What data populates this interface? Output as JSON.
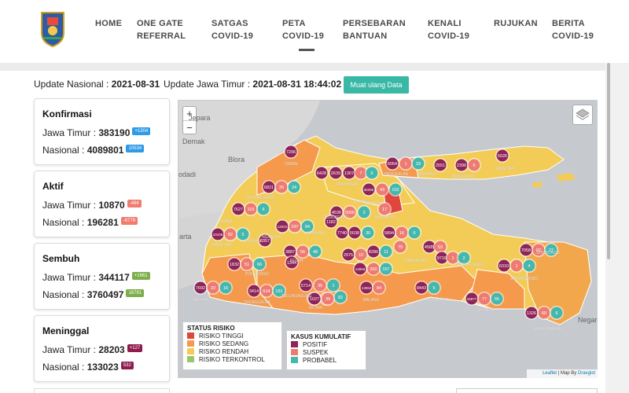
{
  "nav": {
    "items": [
      {
        "line1": "HOME",
        "line2": ""
      },
      {
        "line1": "ONE GATE",
        "line2": "REFERRAL"
      },
      {
        "line1": "SATGAS",
        "line2": "COVID-19"
      },
      {
        "line1": "PETA",
        "line2": "COVID-19"
      },
      {
        "line1": "PERSEBARAN",
        "line2": "BANTUAN"
      },
      {
        "line1": "KENALI",
        "line2": "COVID-19"
      },
      {
        "line1": "RUJUKAN",
        "line2": ""
      },
      {
        "line1": "BERITA",
        "line2": "COVID-19"
      }
    ]
  },
  "update": {
    "national_label": "Update Nasional :",
    "national_value": "2021-08-31",
    "jatim_label": "Update Jawa Timur :",
    "jatim_value": "2021-08-31 18:44:02",
    "reload_label": "Muat ulang Data"
  },
  "cards": [
    {
      "title": "Konfirmasi",
      "jatim_label": "Jawa Timur :",
      "jatim_value": "383190",
      "jatim_delta": "+1304",
      "nas_label": "Nasional :",
      "nas_value": "4089801",
      "nas_delta": "10534"
    },
    {
      "title": "Aktif",
      "jatim_label": "Jawa Timur :",
      "jatim_value": "10870",
      "jatim_delta": "-484",
      "nas_label": "Nasional :",
      "nas_value": "196281",
      "nas_delta": "-6779"
    },
    {
      "title": "Sembuh",
      "jatim_label": "Jawa Timur :",
      "jatim_value": "344117",
      "jatim_delta": "+1661",
      "nas_label": "Nasional :",
      "nas_value": "3760497",
      "nas_delta": "16781"
    },
    {
      "title": "Meninggal",
      "jatim_label": "Jawa Timur :",
      "jatim_value": "28203",
      "jatim_delta": "+127",
      "nas_label": "Nasional :",
      "nas_value": "133023",
      "nas_delta": "532"
    }
  ],
  "colors": {
    "teal": "#3ab8a6",
    "blue_badge": "#2e9be6",
    "red_badge": "#f07b6e",
    "green_badge": "#7cae4a",
    "maroon_badge": "#8e1c4e",
    "risk_high": "#e0473c",
    "risk_medium": "#f59a4c",
    "risk_low": "#f2cc56",
    "risk_controlled": "#9cc46b",
    "positive": "#8e2458",
    "suspect": "#ee7b72",
    "probable": "#45b8ae"
  },
  "map": {
    "zoom_in": "+",
    "zoom_out": "−",
    "geo_labels": [
      "Blora",
      "Demak",
      "Jepara",
      "odadi",
      "arta",
      "Negar"
    ],
    "credit_leaflet": "Leaflet",
    "credit_sep": " | Map By ",
    "credit_author": "Draxgist",
    "legend_risk": {
      "title": "STATUS RISIKO",
      "items": [
        "RISIKO TINGGI",
        "RISIKO SEDANG",
        "RISIKO RENDAH",
        "RISIKO TERKONTROL"
      ]
    },
    "legend_cases": {
      "title": "KASUS KUMULATIF",
      "items": [
        "POSITIF",
        "SUSPEK",
        "PROBABEL"
      ]
    },
    "clusters": [
      {
        "v": "7206",
        "t": "p"
      },
      {
        "v": "6428",
        "t": "p"
      },
      {
        "v": "2639",
        "t": "p"
      },
      {
        "v": "1307",
        "t": "p"
      },
      {
        "v": "7",
        "t": "s"
      },
      {
        "v": "6",
        "t": "b"
      },
      {
        "v": "6054",
        "t": "p"
      },
      {
        "v": "1",
        "t": "s"
      },
      {
        "v": "33",
        "t": "b"
      },
      {
        "v": "2551",
        "t": "p"
      },
      {
        "v": "2396",
        "t": "p"
      },
      {
        "v": "6",
        "t": "s"
      },
      {
        "v": "5026",
        "t": "p"
      },
      {
        "v": "6821",
        "t": "p"
      },
      {
        "v": "26",
        "t": "s"
      },
      {
        "v": "24",
        "t": "b"
      },
      {
        "v": "35365",
        "t": "p"
      },
      {
        "v": "43",
        "t": "s"
      },
      {
        "v": "102",
        "t": "b"
      },
      {
        "v": "7627",
        "t": "p"
      },
      {
        "v": "116",
        "t": "s"
      },
      {
        "v": "6",
        "t": "b"
      },
      {
        "v": "4536",
        "t": "p"
      },
      {
        "v": "5000",
        "t": "s"
      },
      {
        "v": "3",
        "t": "b"
      },
      {
        "v": "17",
        "t": "s"
      },
      {
        "v": "10108",
        "t": "p"
      },
      {
        "v": "82",
        "t": "s"
      },
      {
        "v": "5",
        "t": "b"
      },
      {
        "v": "8357",
        "t": "p"
      },
      {
        "v": "1182",
        "t": "p"
      },
      {
        "v": "12021",
        "t": "p"
      },
      {
        "v": "297",
        "t": "s"
      },
      {
        "v": "84",
        "t": "b"
      },
      {
        "v": "7740",
        "t": "p"
      },
      {
        "v": "5038",
        "t": "p"
      },
      {
        "v": "30",
        "t": "b"
      },
      {
        "v": "5894",
        "t": "p"
      },
      {
        "v": "16",
        "t": "s"
      },
      {
        "v": "6",
        "t": "b"
      },
      {
        "v": "1832",
        "t": "p"
      },
      {
        "v": "51",
        "t": "s"
      },
      {
        "v": "66",
        "t": "b"
      },
      {
        "v": "3887",
        "t": "p"
      },
      {
        "v": "56",
        "t": "s"
      },
      {
        "v": "48",
        "t": "b"
      },
      {
        "v": "2975",
        "t": "p"
      },
      {
        "v": "10",
        "t": "s"
      },
      {
        "v": "8286",
        "t": "p"
      },
      {
        "v": "11",
        "t": "b"
      },
      {
        "v": "79",
        "t": "s"
      },
      {
        "v": "4585",
        "t": "p"
      },
      {
        "v": "53",
        "t": "s"
      },
      {
        "v": "7058",
        "t": "p"
      },
      {
        "v": "62",
        "t": "s"
      },
      {
        "v": "27",
        "t": "b"
      },
      {
        "v": "1344",
        "t": "p"
      },
      {
        "v": "9716",
        "t": "p"
      },
      {
        "v": "1",
        "t": "s"
      },
      {
        "v": "2",
        "t": "b"
      },
      {
        "v": "14856",
        "t": "p"
      },
      {
        "v": "350",
        "t": "s"
      },
      {
        "v": "157",
        "t": "b"
      },
      {
        "v": "6310",
        "t": "p"
      },
      {
        "v": "1",
        "t": "s"
      },
      {
        "v": "4",
        "t": "b"
      },
      {
        "v": "5714",
        "t": "p"
      },
      {
        "v": "35",
        "t": "s"
      },
      {
        "v": "1",
        "t": "b"
      },
      {
        "v": "7692",
        "t": "p"
      },
      {
        "v": "33",
        "t": "s"
      },
      {
        "v": "16",
        "t": "b"
      },
      {
        "v": "3414",
        "t": "p"
      },
      {
        "v": "614",
        "t": "s"
      },
      {
        "v": "191",
        "t": "b"
      },
      {
        "v": "6027",
        "t": "p"
      },
      {
        "v": "10",
        "t": "s"
      },
      {
        "v": "13552",
        "t": "p"
      },
      {
        "v": "84",
        "t": "s"
      },
      {
        "v": "8443",
        "t": "p"
      },
      {
        "v": "5",
        "t": "b"
      },
      {
        "v": "15877",
        "t": "p"
      },
      {
        "v": "77",
        "t": "s"
      },
      {
        "v": "55",
        "t": "b"
      },
      {
        "v": "1027",
        "t": "p"
      },
      {
        "v": "39",
        "t": "s"
      },
      {
        "v": "82",
        "t": "b"
      },
      {
        "v": "1326",
        "t": "p"
      },
      {
        "v": "60",
        "t": "s"
      },
      {
        "v": "6",
        "t": "b"
      }
    ],
    "region_labels": [
      "TUBAN",
      "BOJONEGORO",
      "NGAWI",
      "MAGETAN",
      "MADIUN",
      "PONOROGO",
      "PACITAN",
      "TRENGGALEK",
      "TULUNGAGUNG",
      "BLITAR",
      "KEDIRI",
      "NGANJUK",
      "JOMBANG",
      "MOJOKERTO",
      "LAMONGAN",
      "GRESIK",
      "SURABAYA",
      "SIDOARJO",
      "PASURUAN",
      "MALANG",
      "LUMAJANG",
      "PROBOLINGGO",
      "JEMBER",
      "BANYUWANGI",
      "BONDOWOSO",
      "SITUBONDO",
      "BANGKALAN",
      "SAMPANG",
      "PAMEKASAN",
      "SUMENEP"
    ]
  }
}
